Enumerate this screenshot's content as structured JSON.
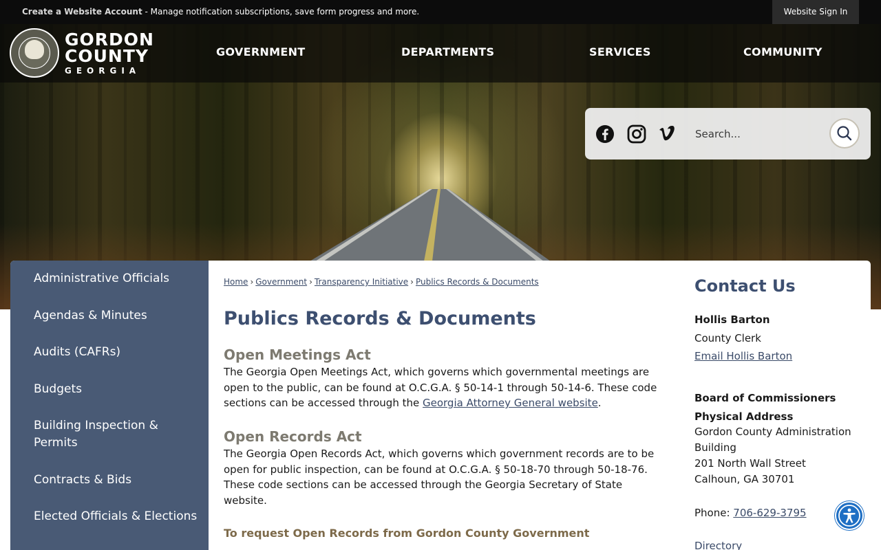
{
  "topbar": {
    "create_account": "Create a Website Account",
    "message": " - Manage notification subscriptions, save form progress and more.",
    "signin": "Website Sign In"
  },
  "logo": {
    "line1": "GORDON",
    "line2": "COUNTY",
    "line3": "GEORGIA"
  },
  "nav": {
    "government": "GOVERNMENT",
    "departments": "DEPARTMENTS",
    "services": "SERVICES",
    "community": "COMMUNITY"
  },
  "search": {
    "placeholder": "Search...",
    "social_icons": [
      "facebook-icon",
      "instagram-icon",
      "vimeo-icon"
    ]
  },
  "sidebar": {
    "items": [
      {
        "label": "Administrative Officials"
      },
      {
        "label": "Agendas & Minutes"
      },
      {
        "label": "Audits (CAFRs)"
      },
      {
        "label": "Budgets"
      },
      {
        "label": "Building Inspection & Permits"
      },
      {
        "label": "Contracts & Bids"
      },
      {
        "label": "Elected Officials & Elections"
      }
    ]
  },
  "breadcrumb": {
    "items": [
      "Home",
      "Government",
      "Transparency Initiative",
      "Publics Records & Documents"
    ]
  },
  "main": {
    "title": "Publics Records & Documents",
    "sections": [
      {
        "heading": "Open Meetings Act",
        "text": "The Georgia Open Meetings Act, which governs which governmental meetings are open to the public, can be found at O.C.G.A. § 50-14-1 through 50-14-6. These code sections can be accessed through the ",
        "link": "Georgia Attorney General website",
        "after": "."
      },
      {
        "heading": "Open Records Act",
        "text": "The Georgia Open Records Act, which governs which government records are to be open for public inspection, can be found at O.C.G.A. § 50-18-70 through 50-18-76. These code sections can be accessed through the Georgia Secretary of State website."
      }
    ],
    "subheading": "To request Open Records from Gordon County Government"
  },
  "contact": {
    "title": "Contact Us",
    "name": "Hollis Barton",
    "role": "County Clerk",
    "email_link": "Email Hollis Barton",
    "org": "Board of Commissioners",
    "address_label": "Physical Address",
    "address_line1": "Gordon County Administration Building",
    "address_line2": "201 North Wall Street",
    "address_line3": "Calhoun, GA 30701",
    "phone_label": "Phone: ",
    "phone": "706-629-3795",
    "directory": "Directory"
  },
  "colors": {
    "nav_text": "#ffffff",
    "sidebar_bg": "#495a75",
    "heading": "#3d4f70",
    "subheading": "#7d7a70",
    "accessibility_button": "#1e6fc4"
  }
}
